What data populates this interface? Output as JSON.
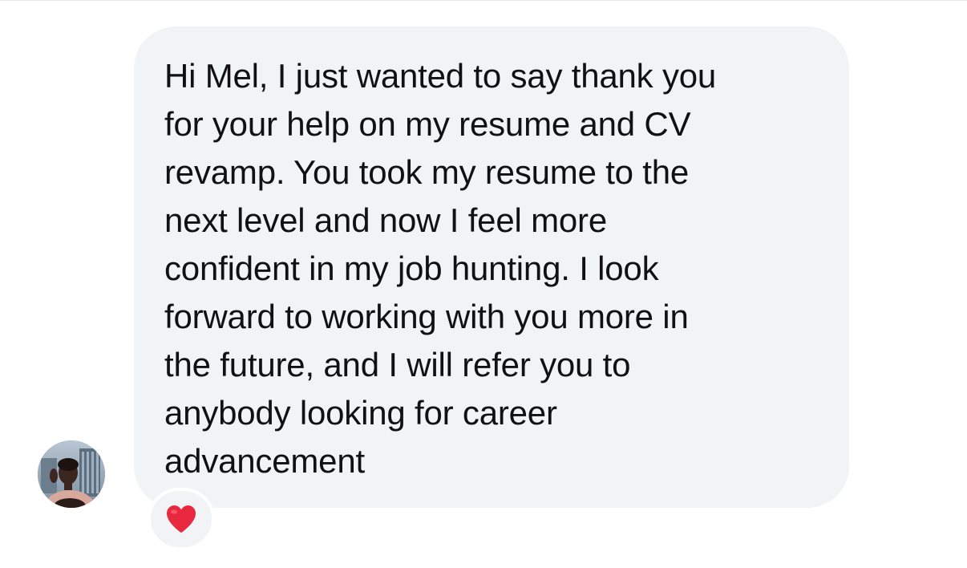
{
  "message": {
    "lines": [
      "Hi Mel, I just wanted to say thank you",
      "for your help on my resume and CV",
      "revamp. You took my resume to the",
      "next level and now I feel more",
      "confident in my job hunting. I look",
      "forward to working with you more in",
      "the future, and I will refer you to",
      "anybody looking for career",
      "advancement"
    ],
    "bubble_color": "#f2f3f5",
    "text_color": "#111111"
  },
  "sender": {
    "avatar_icon": "user-avatar-photo"
  },
  "reaction": {
    "icon": "red-heart-icon",
    "color": "#e8283e"
  }
}
